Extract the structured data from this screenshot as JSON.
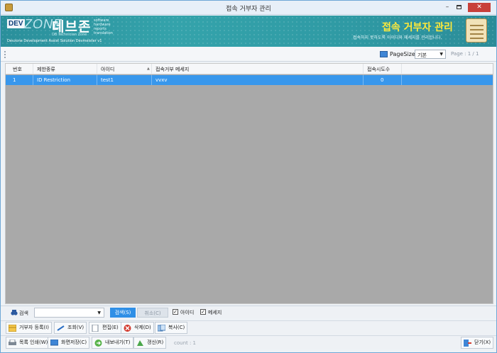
{
  "window": {
    "title": "접속 거부자 관리"
  },
  "banner": {
    "logo_dev": "DEV",
    "logo_zone": "ZONE",
    "logo_korean": "데브존",
    "logo_sub": "DB Technician Zone",
    "logo_list": [
      "software",
      "hardware",
      "reports",
      "translation"
    ],
    "logo_footer": "Devzone Development Assist Solution Devmeister v1",
    "title": "접속 거부자 관리",
    "description": "접속하지 못하도록 아이디와 메세지를 관리합니다."
  },
  "toolbar": {
    "pagesize_label": "PageSize",
    "pagesize_value": "기본",
    "pager": "Page :  1  /  1"
  },
  "grid": {
    "columns": [
      "번호",
      "제한종류",
      "아이디",
      "접속거부 메세지",
      "접속시도수"
    ],
    "rows": [
      {
        "no": "1",
        "type": "ID Restriction",
        "id": "test1",
        "message": "vvxv",
        "attempts": "0"
      }
    ]
  },
  "search": {
    "label": "검색",
    "combo_value": "",
    "search_button": "검색(S)",
    "cancel_button": "취소(C)",
    "check_id": "아이디",
    "check_message": "메세지"
  },
  "buttons_row1": {
    "register": "거부자 등록(I)",
    "query": "조회(V)",
    "edit": "편집(E)",
    "delete": "삭제(D)",
    "copy": "복사(C)"
  },
  "buttons_row2": {
    "print": "목록 인쇄(W)",
    "capture": "화면저장(C)",
    "export": "내보내기(T)",
    "refresh": "갱신(R)",
    "count": "count : 1",
    "close": "닫기(X)"
  },
  "colors": {
    "accent": "#3897ec",
    "banner": "#2f9aa4",
    "banner_title": "#ffe93a",
    "close": "#c8403a"
  }
}
